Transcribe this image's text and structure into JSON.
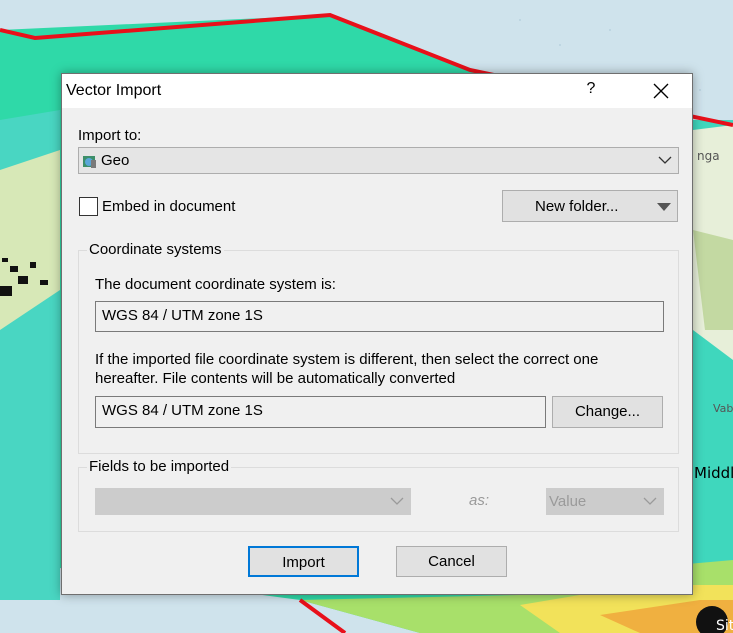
{
  "dialog": {
    "title": "Vector Import",
    "help_symbol": "?",
    "import_to_label": "Import to:",
    "import_to_value": "Geo",
    "embed_label": "Embed in document",
    "embed_checked": false,
    "new_folder_label": "New folder...",
    "coordinate_group_title": "Coordinate systems",
    "document_cs_label": "The document coordinate system is:",
    "document_cs_value": "WGS 84 / UTM zone 1S",
    "imported_cs_label_line1": "If the imported file coordinate system is different, then select the correct one",
    "imported_cs_label_line2": "hereafter. File contents will be automatically converted",
    "imported_cs_value": "WGS 84 / UTM zone 1S",
    "change_label": "Change...",
    "fields_group_title": "Fields to be imported",
    "fields_value": "",
    "as_label": "as:",
    "as_value": "Value",
    "import_button": "Import",
    "cancel_button": "Cancel"
  },
  "map": {
    "labels": [
      "nga",
      "Middl",
      "Vab",
      "Sit"
    ]
  },
  "icons": [
    "folder-icon",
    "chevron-down-icon",
    "close-icon",
    "dropdown-arrow-icon"
  ]
}
